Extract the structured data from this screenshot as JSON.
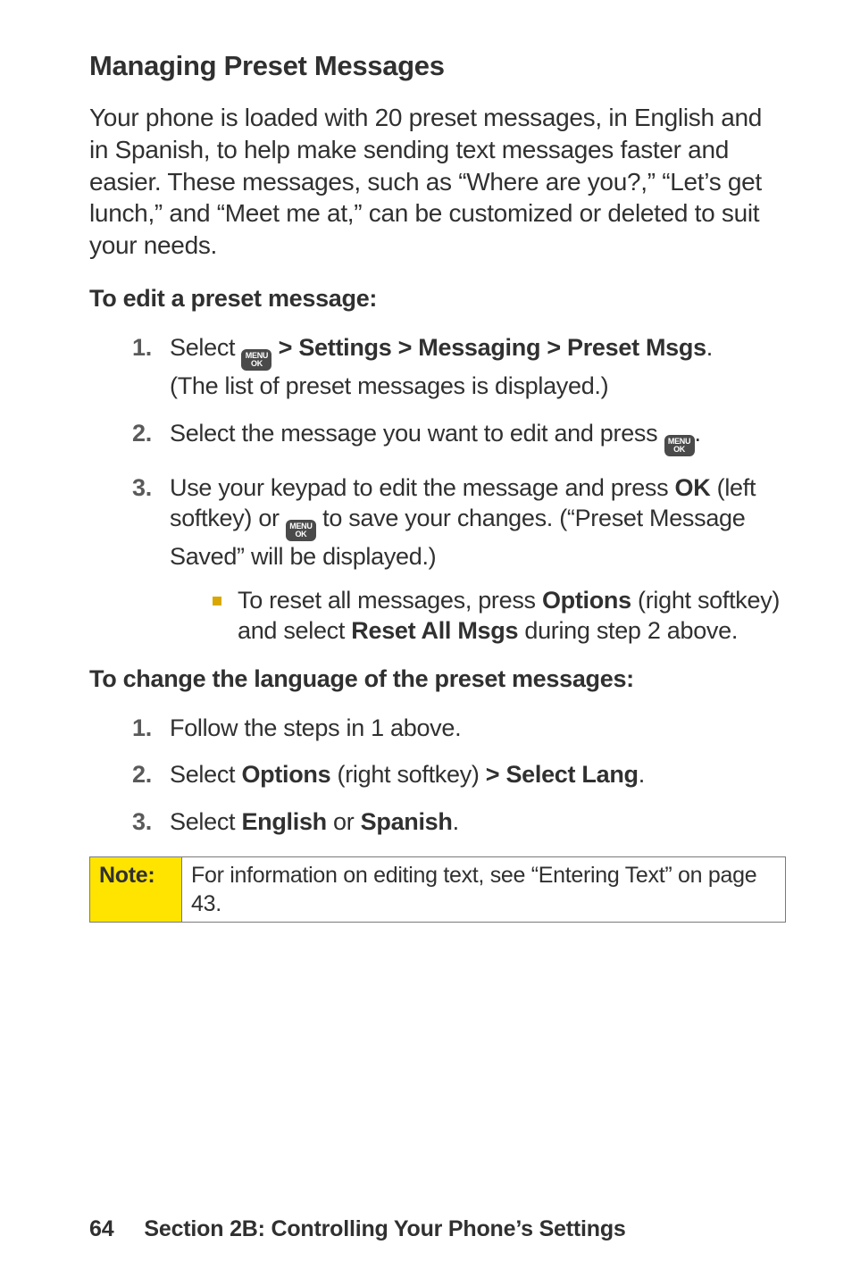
{
  "heading": "Managing Preset Messages",
  "intro": "Your phone is loaded with 20 preset messages, in English and in Spanish, to help make sending text messages faster and easier. These messages, such as “Where are you?,” “Let’s get lunch,” and “Meet me at,” can be customized or deleted to suit your needs.",
  "sub1": "To edit a preset message:",
  "menu_icon": {
    "top": "MENU",
    "bot": "OK"
  },
  "steps1": {
    "s1": {
      "num": "1.",
      "pre": "Select ",
      "menu_after": " > Settings > Messaging > Preset Msgs",
      "post": "(The list of preset messages is displayed.)"
    },
    "s2": {
      "num": "2.",
      "pre": "Select the message you want to edit and press ",
      "post": "."
    },
    "s3": {
      "num": "3.",
      "pre1": "Use your keypad to edit the message and press ",
      "ok": "OK",
      "pre2": " (left softkey) or ",
      "post": " to save your changes. (“Preset Message Saved” will be displayed.)",
      "bullet": {
        "pre": "To reset all messages, press ",
        "opt": "Options",
        "mid": " (right softkey) and select ",
        "reset": "Reset All Msgs",
        "post": " during step 2 above."
      }
    }
  },
  "sub2": "To change the language of the preset messages:",
  "steps2": {
    "s1": {
      "num": "1.",
      "text": "Follow the steps in 1 above."
    },
    "s2": {
      "num": "2.",
      "pre": "Select ",
      "opt": "Options",
      "mid": " (right softkey) ",
      "sel": "> Select Lang",
      "post": "."
    },
    "s3": {
      "num": "3.",
      "pre": "Select ",
      "eng": "English",
      "or": " or ",
      "spa": "Spanish",
      "post": "."
    }
  },
  "note": {
    "label": "Note:",
    "text": "For information on editing text, see “Entering Text” on page 43."
  },
  "footer": {
    "page": "64",
    "section": "Section 2B: Controlling Your Phone’s Settings"
  }
}
